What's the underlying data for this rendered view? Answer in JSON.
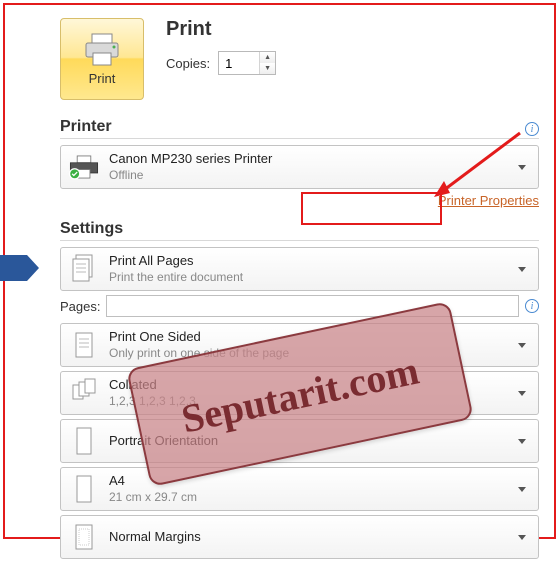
{
  "header": {
    "print_title": "Print",
    "print_button": "Print",
    "copies_label": "Copies:",
    "copies_value": "1"
  },
  "printer_section": {
    "title": "Printer",
    "selected_name": "Canon MP230 series Printer",
    "selected_status": "Offline",
    "properties_link": "Printer Properties"
  },
  "settings_section": {
    "title": "Settings",
    "pages_label": "Pages:",
    "pages_value": "",
    "items": [
      {
        "title": "Print All Pages",
        "sub": "Print the entire document"
      },
      {
        "title": "Print One Sided",
        "sub": "Only print on one side of the page"
      },
      {
        "title": "Collated",
        "sub": "1,2,3   1,2,3   1,2,3"
      },
      {
        "title": "Portrait Orientation",
        "sub": ""
      },
      {
        "title": "A4",
        "sub": "21 cm x 29.7 cm"
      },
      {
        "title": "Normal Margins",
        "sub": ""
      }
    ]
  },
  "watermark": "Seputarit.com"
}
